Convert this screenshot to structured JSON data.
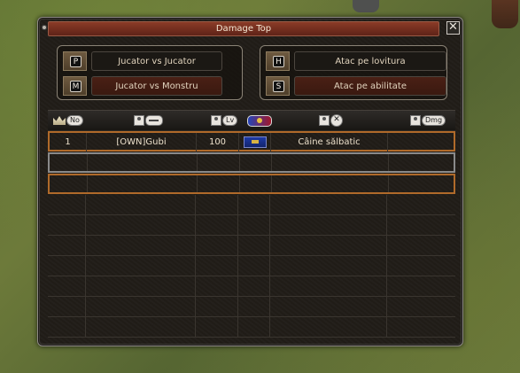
{
  "window": {
    "title": "Damage Top",
    "close_label": "✕"
  },
  "modes": {
    "player": [
      {
        "key": "P",
        "label": "Jucator vs Jucator",
        "active": false
      },
      {
        "key": "M",
        "label": "Jucator vs Monstru",
        "active": true
      }
    ],
    "attack": [
      {
        "key": "H",
        "label": "Atac pe lovitura",
        "active": false
      },
      {
        "key": "S",
        "label": "Atac pe abilitate",
        "active": true
      }
    ]
  },
  "table": {
    "headers": {
      "rank": "No",
      "level": "Lv",
      "damage": "Dmg"
    },
    "rows": [
      {
        "rank": "1",
        "name": "[OWN]Gubi",
        "level": "100",
        "empire": "blue-empire",
        "target": "Câine sălbatic",
        "damage": ""
      }
    ]
  },
  "colors": {
    "titlebar": "#6e2b1d",
    "highlight_orange": "#b06a2a",
    "highlight_grey": "#8a8a8a",
    "panel": "#211d18"
  }
}
